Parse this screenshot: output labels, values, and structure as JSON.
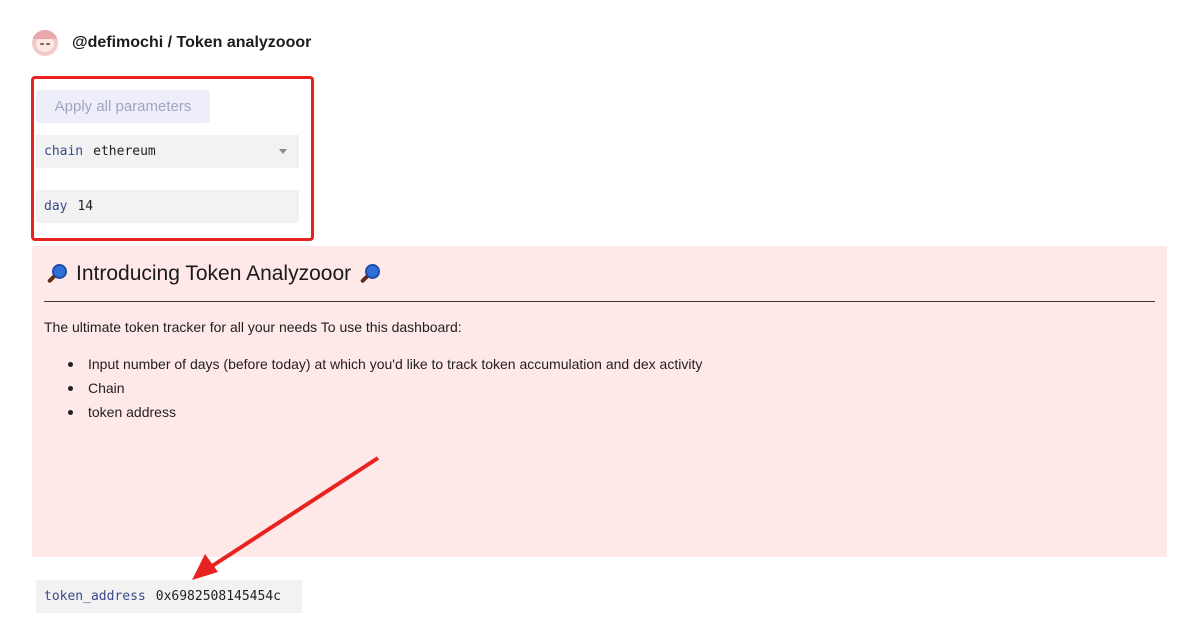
{
  "header": {
    "breadcrumb": "@defimochi / Token analyzooor"
  },
  "parameters": {
    "apply_label": "Apply all parameters",
    "chain": {
      "name": "chain",
      "value": "ethereum"
    },
    "day": {
      "name": "day",
      "value": "14"
    },
    "token_address": {
      "name": "token_address",
      "value": "0x6982508145454c"
    }
  },
  "panel": {
    "title": "Introducing Token Analyzooor",
    "intro": "The ultimate token tracker for all your needs To use this dashboard:",
    "bullets": [
      "Input number of days (before today) at which you'd like to track token accumulation and dex activity",
      "Chain",
      "token address"
    ]
  },
  "colors": {
    "highlight_border": "#e8231f",
    "panel_background": "#ffe8e8",
    "arrow": "#e8231f",
    "param_name": "#3b4a8a"
  },
  "icons": {
    "title_leading": "magnifying-glass-icon",
    "title_trailing": "magnifying-glass-icon",
    "caret": "chevron-down-icon"
  }
}
